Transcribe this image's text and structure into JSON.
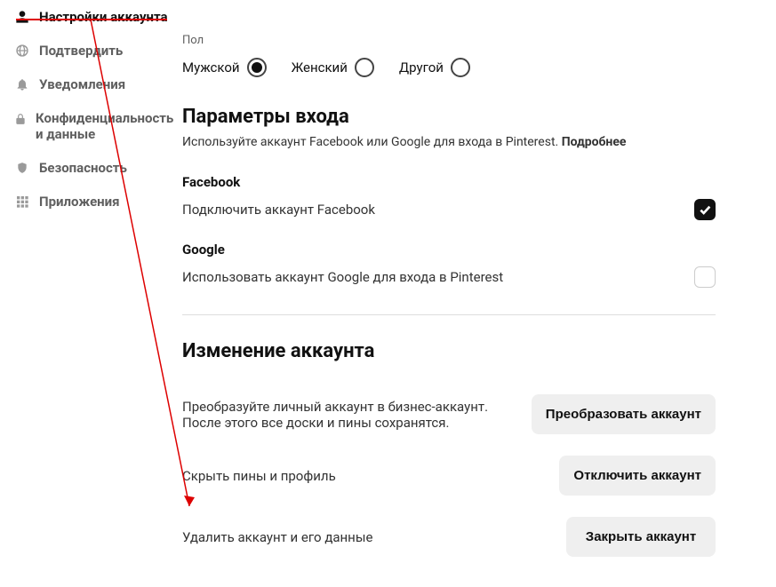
{
  "sidebar": {
    "items": [
      {
        "label": "Настройки аккаунта"
      },
      {
        "label": "Подтвердить"
      },
      {
        "label": "Уведомления"
      },
      {
        "label": "Конфиденциальность и данные"
      },
      {
        "label": "Безопасность"
      },
      {
        "label": "Приложения"
      }
    ]
  },
  "gender": {
    "label": "Пол",
    "options": {
      "male": "Мужской",
      "female": "Женский",
      "other": "Другой"
    }
  },
  "login": {
    "heading": "Параметры входа",
    "desc_prefix": "Используйте аккаунт Facebook или Google для входа в Pinterest. ",
    "desc_more": "Подробнее",
    "facebook": {
      "name": "Facebook",
      "desc": "Подключить аккаунт Facebook"
    },
    "google": {
      "name": "Google",
      "desc": "Использовать аккаунт Google для входа в Pinterest"
    }
  },
  "changes": {
    "heading": "Изменение аккаунта",
    "convert_desc": "Преобразуйте личный аккаунт в бизнес-аккаунт. После этого все доски и пины сохранятся.",
    "convert_btn": "Преобразовать аккаунт",
    "hide_desc": "Скрыть пины и профиль",
    "hide_btn": "Отключить аккаунт",
    "delete_desc": "Удалить аккаунт и его данные",
    "delete_btn": "Закрыть аккаунт"
  }
}
